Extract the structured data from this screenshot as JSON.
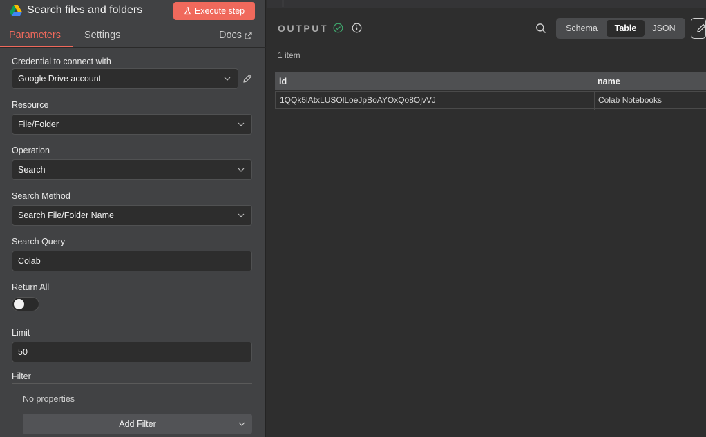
{
  "node": {
    "title": "Search files and folders",
    "execute_label": "Execute step"
  },
  "tabs": {
    "parameters": "Parameters",
    "settings": "Settings",
    "docs": "Docs"
  },
  "params": {
    "credential": {
      "label": "Credential to connect with",
      "value": "Google Drive account"
    },
    "resource": {
      "label": "Resource",
      "value": "File/Folder"
    },
    "operation": {
      "label": "Operation",
      "value": "Search"
    },
    "search_method": {
      "label": "Search Method",
      "value": "Search File/Folder Name"
    },
    "search_query": {
      "label": "Search Query",
      "value": "Colab"
    },
    "return_all": {
      "label": "Return All",
      "value": false
    },
    "limit": {
      "label": "Limit",
      "value": "50"
    },
    "filter": {
      "label": "Filter",
      "empty_text": "No properties",
      "add_label": "Add Filter"
    }
  },
  "output": {
    "title": "OUTPUT",
    "item_count": "1 item",
    "views": [
      "Schema",
      "Table",
      "JSON"
    ],
    "active_view": "Table",
    "table": {
      "columns": [
        "id",
        "name"
      ],
      "rows": [
        [
          "1QQk5lAtxLUSOlLoeJpBoAYOxQo8OjvVJ",
          "Colab Notebooks"
        ]
      ]
    }
  },
  "colors": {
    "accent": "#f0695c",
    "success": "#3fa56c"
  },
  "icons": [
    "google-drive-icon",
    "flask-icon",
    "external-link-icon",
    "chevron-down-icon",
    "pencil-icon",
    "check-circle-icon",
    "info-icon",
    "search-icon"
  ]
}
